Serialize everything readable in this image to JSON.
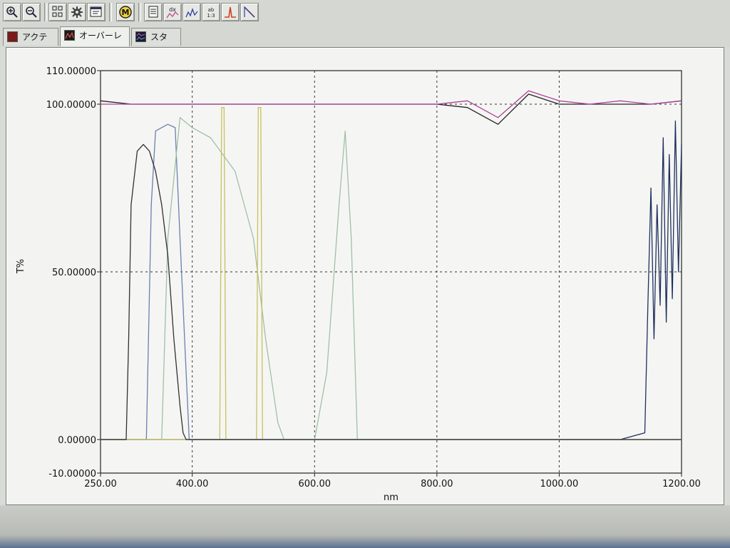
{
  "toolbar": {
    "buttons": [
      {
        "name": "zoom-in-icon"
      },
      {
        "name": "zoom-out-icon"
      },
      {
        "name": "layout-icon"
      },
      {
        "name": "settings-gear-icon"
      },
      {
        "name": "properties-icon"
      },
      {
        "name": "method-m-icon"
      },
      {
        "name": "report-icon"
      },
      {
        "name": "derivative-icon"
      },
      {
        "name": "smoothing-icon"
      },
      {
        "name": "ratio-icon"
      },
      {
        "name": "peak-pick-icon"
      },
      {
        "name": "curve-tool-icon"
      }
    ]
  },
  "tabs": [
    {
      "label": "アクティブ",
      "active": false
    },
    {
      "label": "オーバーレイ",
      "active": true
    },
    {
      "label": "スタック",
      "active": false
    }
  ],
  "colors": {
    "panel_bg": "#f3f4f1",
    "plot_bg": "#f5f6f3",
    "gridline": "#333333"
  },
  "chart_data": {
    "type": "line",
    "title": "",
    "xlabel": "nm",
    "ylabel": "T%",
    "xlim": [
      250,
      1200
    ],
    "ylim": [
      -10,
      110
    ],
    "x_ticks": [
      "250.00",
      "400.00",
      "600.00",
      "800.00",
      "1000.00",
      "1200.00"
    ],
    "x_tick_values": [
      250,
      400,
      600,
      800,
      1000,
      1200
    ],
    "y_ticks": [
      "110.00000",
      "100.00000",
      "50.00000",
      "0.00000",
      "-10.00000"
    ],
    "y_tick_values": [
      110,
      100,
      50,
      0,
      -10
    ],
    "grid": {
      "style": "dashed",
      "x": [
        400,
        600,
        800,
        1000
      ],
      "y": [
        50,
        100
      ]
    },
    "legend": "none",
    "series": [
      {
        "color": "#222222",
        "x": [
          250,
          300,
          350,
          400,
          450,
          500,
          550,
          600,
          650,
          700,
          750,
          800,
          850,
          900,
          950,
          1000,
          1050,
          1100,
          1150,
          1200
        ],
        "y": [
          101,
          100,
          100,
          100,
          100,
          100,
          100,
          100,
          100,
          100,
          100,
          100,
          99,
          94,
          103,
          100,
          100,
          100,
          100,
          101
        ]
      },
      {
        "color": "#b0409a",
        "x": [
          250,
          300,
          350,
          400,
          450,
          500,
          550,
          600,
          650,
          700,
          750,
          800,
          850,
          900,
          950,
          1000,
          1050,
          1100,
          1150,
          1200
        ],
        "y": [
          100,
          100,
          100,
          100,
          100,
          100,
          100,
          100,
          100,
          100,
          100,
          100,
          101,
          96,
          104,
          101,
          100,
          101,
          100,
          101
        ]
      },
      {
        "color": "#6a7fb0",
        "x": [
          250,
          325,
          333,
          340,
          360,
          372,
          380,
          395,
          400,
          430,
          500,
          550,
          600,
          800,
          1000,
          1200
        ],
        "y": [
          0,
          0,
          70,
          92,
          94,
          93,
          60,
          0,
          0,
          0,
          0,
          0,
          0,
          0,
          0,
          0
        ]
      },
      {
        "color": "#1f2f5f",
        "x": [
          250,
          1100,
          1140,
          1145,
          1150,
          1155,
          1160,
          1165,
          1170,
          1175,
          1180,
          1185,
          1190,
          1195,
          1200
        ],
        "y": [
          0,
          0,
          2,
          40,
          75,
          30,
          70,
          40,
          90,
          35,
          85,
          42,
          95,
          50,
          88
        ]
      },
      {
        "color": "#9fc0a8",
        "x": [
          250,
          350,
          360,
          380,
          400,
          430,
          470,
          500,
          520,
          540,
          550,
          560,
          600,
          620,
          640,
          650,
          660,
          670,
          1200
        ],
        "y": [
          0,
          0,
          60,
          96,
          93,
          90,
          80,
          60,
          30,
          5,
          0,
          0,
          0,
          20,
          70,
          92,
          60,
          0,
          0
        ]
      },
      {
        "color": "#c8c060",
        "x": [
          250,
          445,
          448,
          452,
          455,
          505,
          508,
          512,
          515,
          1200
        ],
        "y": [
          0,
          0,
          99,
          99,
          0,
          0,
          99,
          99,
          0,
          0
        ]
      },
      {
        "color": "#303030",
        "x": [
          250,
          292,
          296,
          300,
          310,
          320,
          330,
          340,
          350,
          360,
          370,
          380,
          385,
          390,
          1200
        ],
        "y": [
          0,
          0,
          30,
          70,
          86,
          88,
          86,
          80,
          70,
          55,
          30,
          10,
          2,
          0,
          0
        ]
      }
    ]
  }
}
